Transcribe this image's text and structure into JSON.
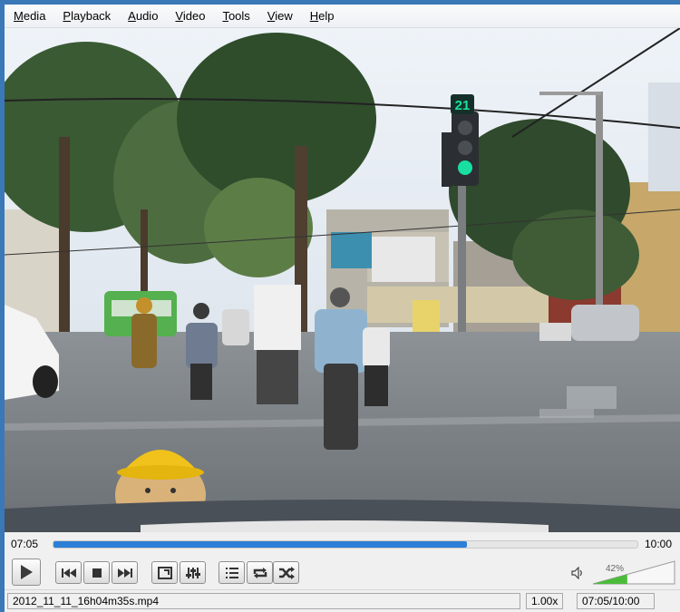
{
  "menu": {
    "items": [
      {
        "label": "Media",
        "underline": "M",
        "rest": "edia"
      },
      {
        "label": "Playback",
        "underline": "P",
        "rest": "layback"
      },
      {
        "label": "Audio",
        "underline": "A",
        "rest": "udio"
      },
      {
        "label": "Video",
        "underline": "V",
        "rest": "ideo"
      },
      {
        "label": "Tools",
        "underline": "T",
        "rest": "ools"
      },
      {
        "label": "View",
        "underline": "V",
        "rest": "iew"
      },
      {
        "label": "Help",
        "underline": "H",
        "rest": "elp"
      }
    ]
  },
  "video": {
    "traffic_light_countdown": "21"
  },
  "playback": {
    "elapsed": "07:05",
    "total": "10:00",
    "progress_fraction": 0.708
  },
  "volume": {
    "label": "42%",
    "level_fraction": 0.42
  },
  "status": {
    "filename": "2012_11_11_16h04m35s.mp4",
    "speed": "1.00x",
    "time": "07:05/10:00"
  },
  "icons": {
    "play": "play-icon",
    "previous": "previous-icon",
    "stop": "stop-icon",
    "next": "next-icon",
    "fullscreen": "fullscreen-icon",
    "extended_settings": "equalizer-icon",
    "playlist": "playlist-icon",
    "loop": "loop-icon",
    "shuffle": "shuffle-icon",
    "speaker": "speaker-icon"
  },
  "colors": {
    "seek_fill": "#2c7fd6",
    "volume_fill": "#4cbb3c",
    "traffic_green": "#19e0a0"
  }
}
